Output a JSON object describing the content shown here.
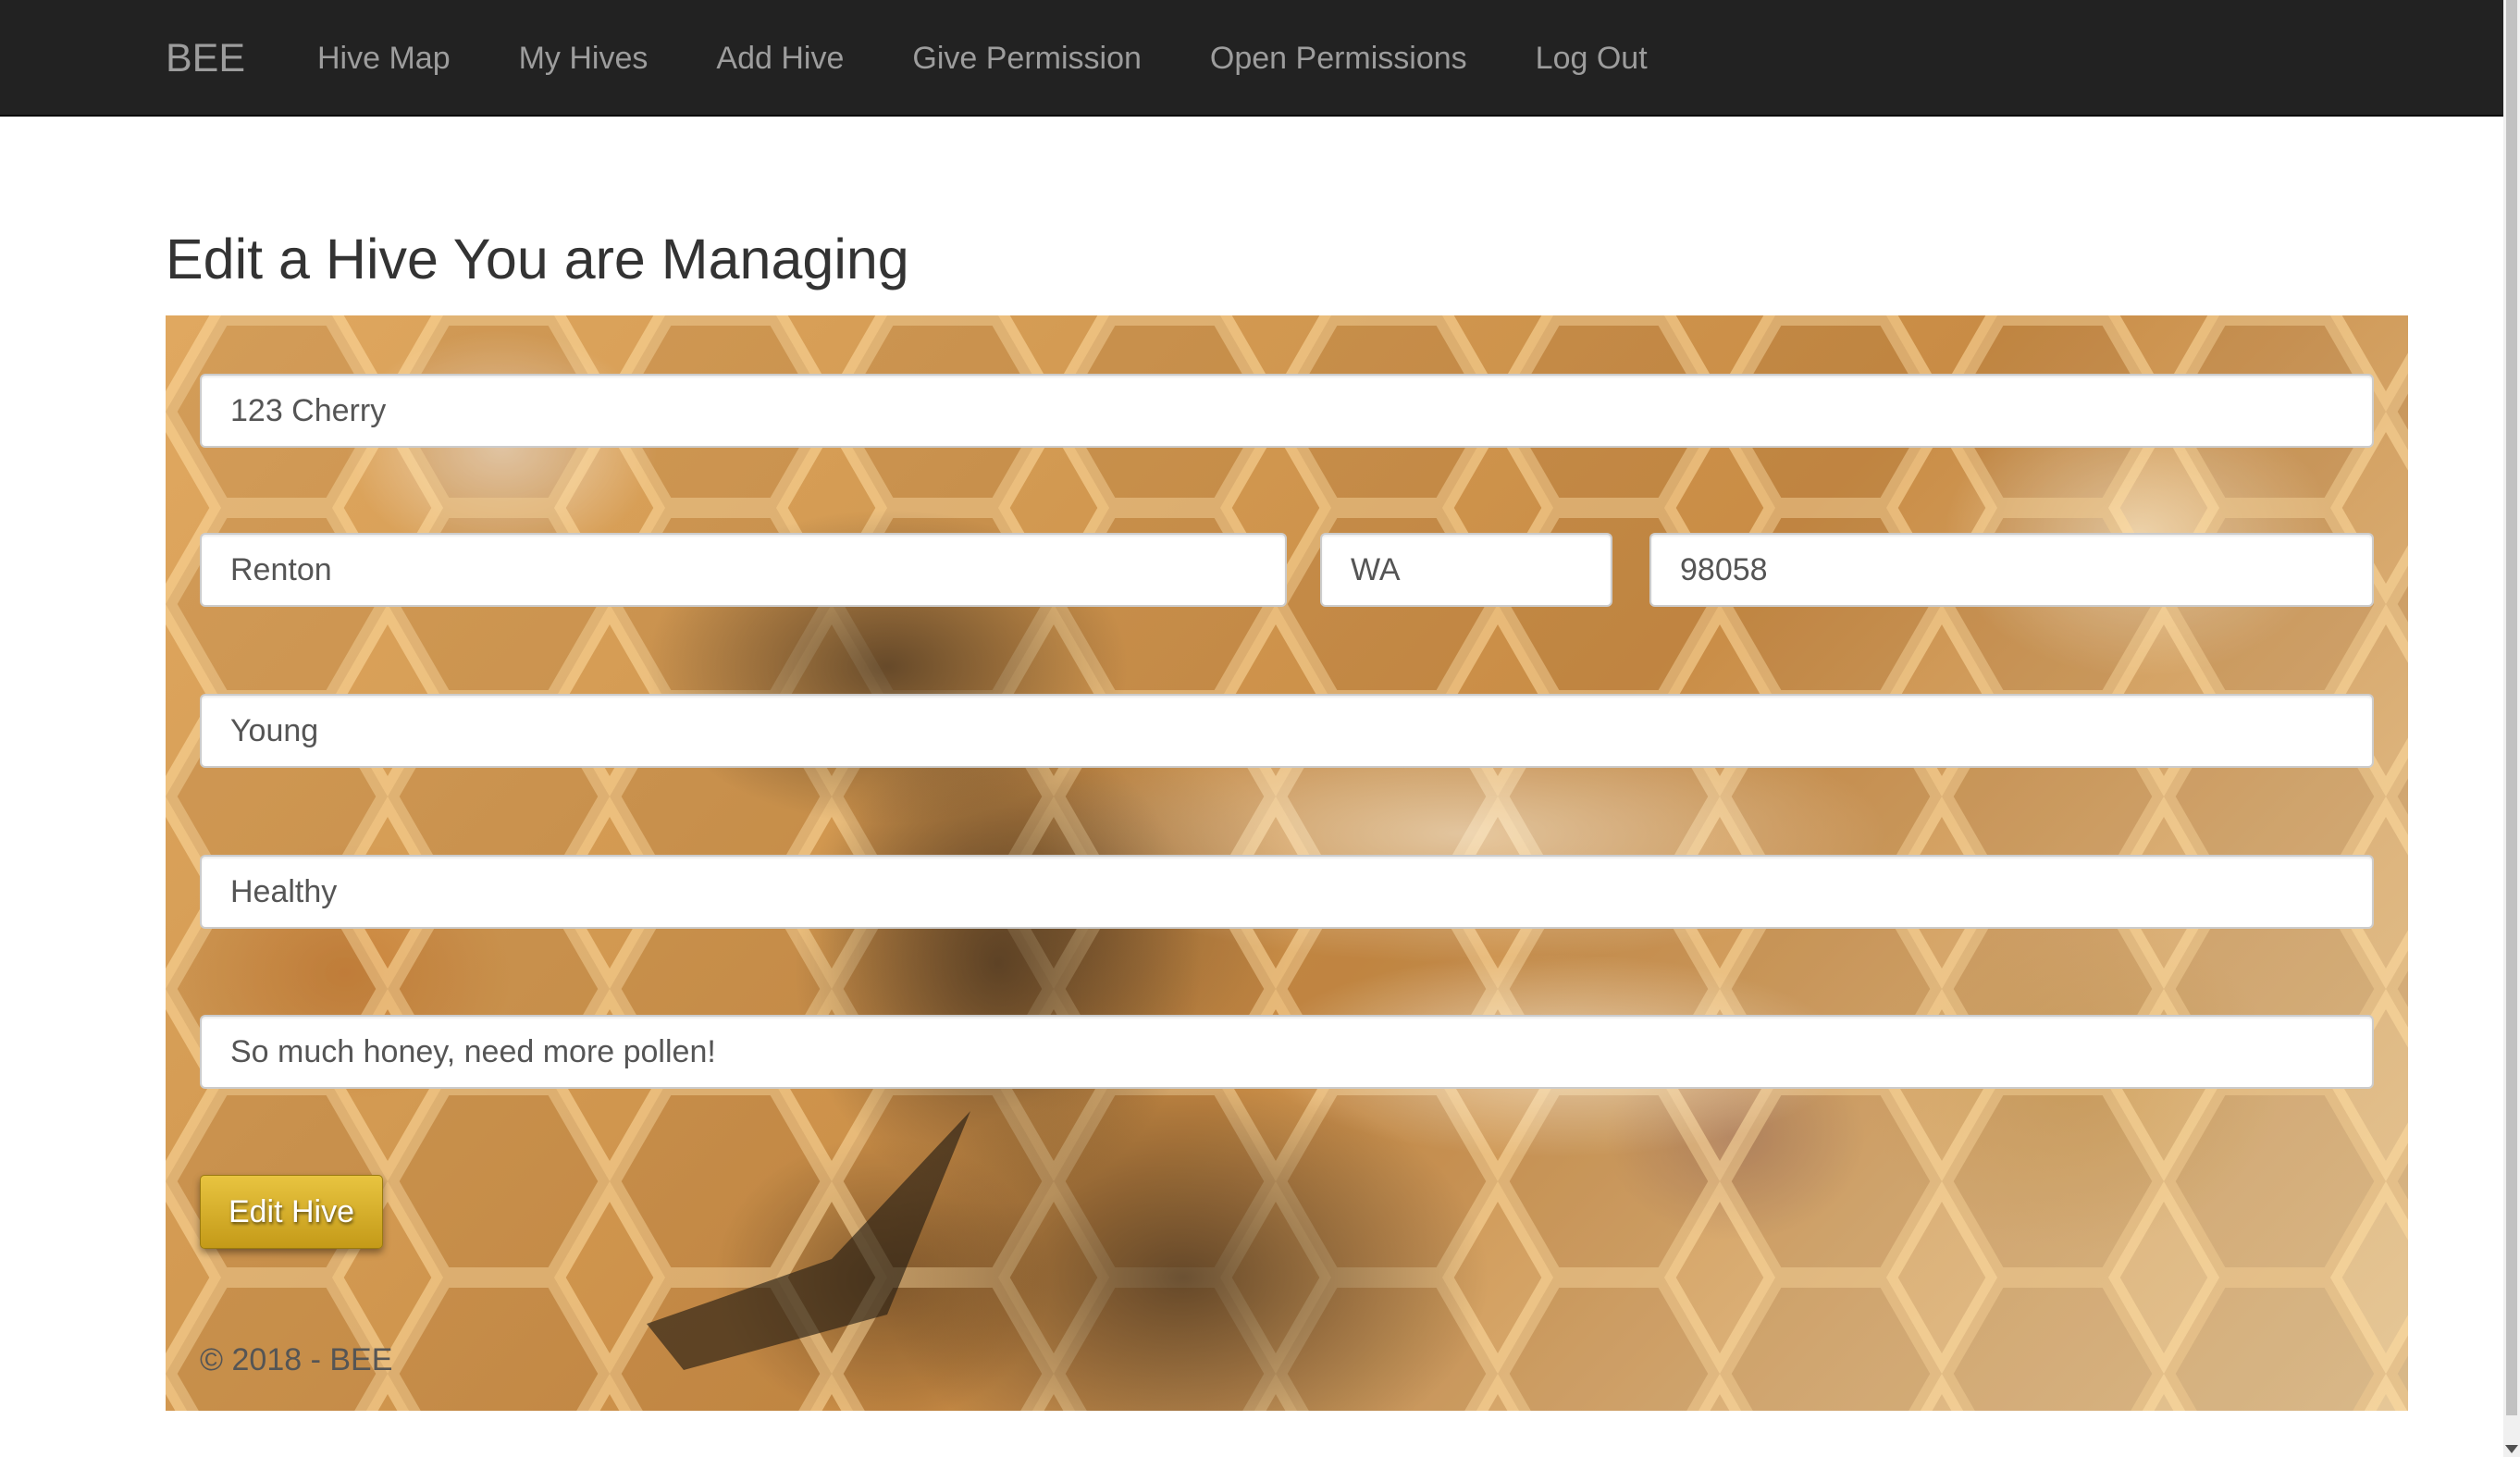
{
  "navbar": {
    "brand": "BEE",
    "items": [
      {
        "label": "Hive Map"
      },
      {
        "label": "My Hives"
      },
      {
        "label": "Add Hive"
      },
      {
        "label": "Give Permission"
      },
      {
        "label": "Open Permissions"
      },
      {
        "label": "Log Out"
      }
    ]
  },
  "page": {
    "title": "Edit a Hive You are Managing"
  },
  "form": {
    "address": {
      "value": "123 Cherry"
    },
    "city": {
      "value": "Renton"
    },
    "state": {
      "value": "WA"
    },
    "zip": {
      "value": "98058"
    },
    "age": {
      "value": "Young"
    },
    "health": {
      "value": "Healthy"
    },
    "notes": {
      "value": "So much honey, need more pollen!"
    },
    "submit_label": "Edit Hive"
  },
  "footer": {
    "text": "© 2018 - BEE"
  },
  "colors": {
    "navbar_bg": "#222222",
    "nav_text": "#9d9d9d",
    "button_gold": "#d4ab2a"
  }
}
